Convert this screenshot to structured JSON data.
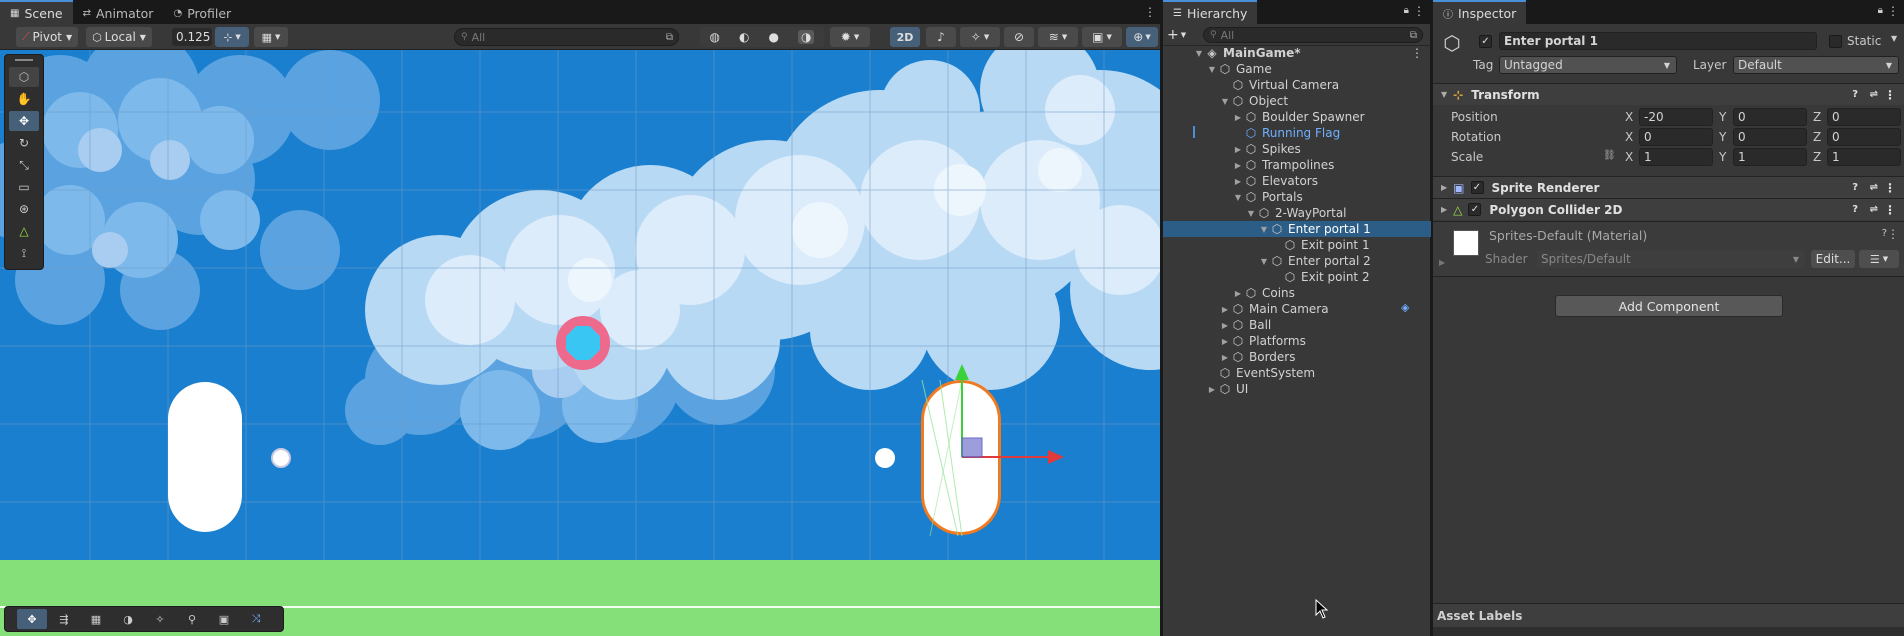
{
  "scene": {
    "tabs": [
      {
        "label": "Scene",
        "icon": "grid-icon"
      },
      {
        "label": "Animator",
        "icon": "animator-icon"
      },
      {
        "label": "Profiler",
        "icon": "profiler-icon"
      }
    ],
    "pivot_label": "Pivot",
    "space_label": "Local",
    "grid_value": "0.125",
    "search_placeholder": "All",
    "mode_2d_label": "2D"
  },
  "hierarchy": {
    "tab_label": "Hierarchy",
    "search_placeholder": "All",
    "items": [
      {
        "label": "MainGame*",
        "depth": 0,
        "caret": "down",
        "icon": "unity-scene-icon",
        "bold": true
      },
      {
        "label": "Game",
        "depth": 1,
        "caret": "down",
        "icon": "cube-icon"
      },
      {
        "label": "Virtual Camera",
        "depth": 2,
        "caret": "",
        "icon": "cube-icon"
      },
      {
        "label": "Object",
        "depth": 2,
        "caret": "down",
        "icon": "cube-icon"
      },
      {
        "label": "Boulder Spawner",
        "depth": 3,
        "caret": "right",
        "icon": "cube-icon"
      },
      {
        "label": "Running Flag",
        "depth": 3,
        "caret": "",
        "icon": "prefab-cube-icon",
        "prefab": true
      },
      {
        "label": "Spikes",
        "depth": 3,
        "caret": "right",
        "icon": "cube-icon"
      },
      {
        "label": "Trampolines",
        "depth": 3,
        "caret": "right",
        "icon": "cube-icon"
      },
      {
        "label": "Elevators",
        "depth": 3,
        "caret": "right",
        "icon": "cube-icon"
      },
      {
        "label": "Portals",
        "depth": 3,
        "caret": "down",
        "icon": "cube-icon"
      },
      {
        "label": "2-WayPortal",
        "depth": 4,
        "caret": "down",
        "icon": "cube-icon"
      },
      {
        "label": "Enter portal 1",
        "depth": 5,
        "caret": "down",
        "icon": "cube-icon",
        "selected": true
      },
      {
        "label": "Exit point 1",
        "depth": 6,
        "caret": "",
        "icon": "cube-icon"
      },
      {
        "label": "Enter portal 2",
        "depth": 5,
        "caret": "down",
        "icon": "cube-icon"
      },
      {
        "label": "Exit point 2",
        "depth": 6,
        "caret": "",
        "icon": "cube-icon"
      },
      {
        "label": "Coins",
        "depth": 3,
        "caret": "right",
        "icon": "cube-icon"
      },
      {
        "label": "Main Camera",
        "depth": 2,
        "caret": "right",
        "icon": "cube-icon"
      },
      {
        "label": "Ball",
        "depth": 2,
        "caret": "right",
        "icon": "cube-icon"
      },
      {
        "label": "Platforms",
        "depth": 2,
        "caret": "right",
        "icon": "cube-icon"
      },
      {
        "label": "Borders",
        "depth": 2,
        "caret": "right",
        "icon": "cube-icon"
      },
      {
        "label": "EventSystem",
        "depth": 1,
        "caret": "",
        "icon": "cube-icon"
      },
      {
        "label": "UI",
        "depth": 1,
        "caret": "right",
        "icon": "cube-icon"
      }
    ]
  },
  "inspector": {
    "tab_label": "Inspector",
    "object_name": "Enter portal 1",
    "static_label": "Static",
    "tag_label": "Tag",
    "tag_value": "Untagged",
    "layer_label": "Layer",
    "layer_value": "Default",
    "transform": {
      "title": "Transform",
      "position_label": "Position",
      "rotation_label": "Rotation",
      "scale_label": "Scale",
      "position": {
        "x": "-20",
        "y": "0",
        "z": "0"
      },
      "rotation": {
        "x": "0",
        "y": "0",
        "z": "0"
      },
      "scale": {
        "x": "1",
        "y": "1",
        "z": "1"
      },
      "axis": {
        "x": "X",
        "y": "Y",
        "z": "Z"
      }
    },
    "sprite_renderer_title": "Sprite Renderer",
    "polygon_collider_title": "Polygon Collider 2D",
    "material_title": "Sprites-Default (Material)",
    "shader_label": "Shader",
    "shader_value": "Sprites/Default",
    "edit_label": "Edit...",
    "add_component_label": "Add Component",
    "asset_labels_title": "Asset Labels"
  },
  "colors": {
    "accent": "#2c5d87",
    "sky": "#1a7fcf",
    "ground": "#86e07a",
    "portal_ring": "#ee6a8d",
    "portal_core": "#3ac6f2",
    "selection_outline": "#f07a20"
  }
}
